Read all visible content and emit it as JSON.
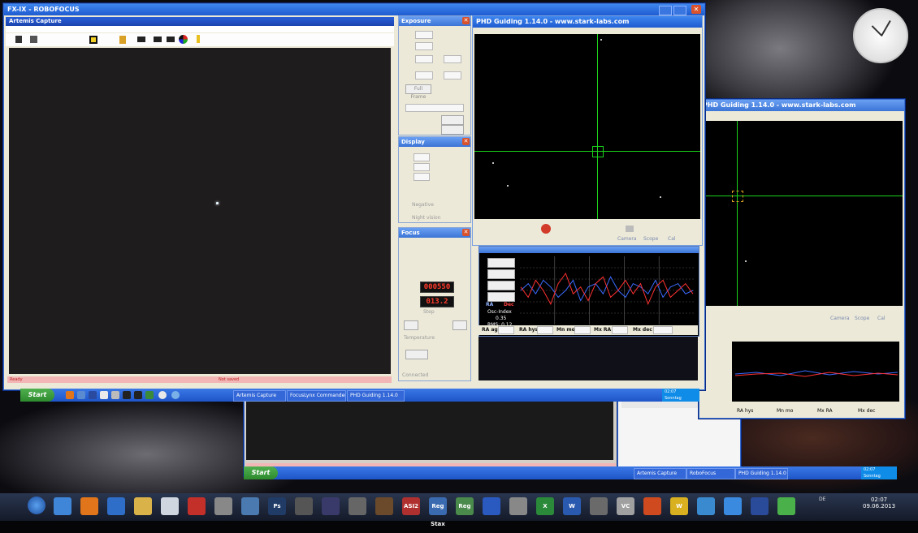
{
  "artemis": {
    "title": "Artemis Capture",
    "window_top_title": "FX-IX - ROBOFOCUS",
    "status": {
      "left": "Ready",
      "mid": "Not saved"
    }
  },
  "exposure_panel": {
    "title": "Exposure",
    "full_frame": "Full Frame"
  },
  "display_panel": {
    "title": "Display",
    "negative": "Negative",
    "night_vision": "Night vision"
  },
  "focus_panel": {
    "title": "Focus",
    "position": "000550",
    "temperature": "013.2",
    "step_label": "Step",
    "temp_label": "Temperature",
    "connected": "Connected"
  },
  "phd_main": {
    "title": "PHD Guiding 1.14.0  -  www.stark-labs.com",
    "camera": "Camera",
    "scope": "Scope",
    "cal": "Cal"
  },
  "phd_graph": {
    "ra_label": "RA",
    "dec_label": "Dec",
    "osc_label": "Osc-Index",
    "osc_value": "0.35",
    "rms": "RMS: 0.12",
    "ra_agr": "RA agr",
    "ra_hys": "RA hys",
    "mn_mo": "Mn mo",
    "mx_ra": "Mx RA",
    "mx_dec": "Mx dec",
    "ra_color": "#ff3030",
    "dec_color": "#3a6bff",
    "chart_data": {
      "type": "line",
      "series": [
        {
          "name": "RA",
          "values": [
            0.1,
            -0.2,
            0.3,
            0.0,
            -0.4,
            0.2,
            0.5,
            -0.1,
            0.1,
            -0.3,
            0.2,
            0.4,
            -0.2,
            0.0,
            0.3,
            -0.1,
            0.2,
            -0.4,
            0.1,
            0.3,
            -0.2,
            0.0,
            0.2,
            -0.1
          ]
        },
        {
          "name": "Dec",
          "values": [
            0.0,
            0.2,
            -0.1,
            0.3,
            0.1,
            -0.2,
            0.0,
            0.3,
            -0.3,
            0.1,
            0.2,
            -0.1,
            0.4,
            0.0,
            -0.2,
            0.2,
            0.1,
            -0.1,
            0.3,
            -0.2,
            0.1,
            0.2,
            -0.1,
            0.0
          ]
        }
      ],
      "ylim": [
        -1,
        1
      ]
    }
  },
  "phd_second": {
    "title": "PHD Guiding 1.14.0  -  www.stark-labs.com",
    "camera": "Camera",
    "scope": "Scope",
    "cal": "Cal",
    "ra_hys": "RA hys",
    "mn_mo": "Mn mo",
    "mx_ra": "Mx RA",
    "mx_dec": "Mx dec"
  },
  "xp_taskbar_main": {
    "start": "Start",
    "tasks": [
      "Artemis Capture",
      "FocusLynx Commander",
      "PHD Guiding 1.14.0"
    ],
    "tray_time": "02:07",
    "tray_day": "Sonntag"
  },
  "xp_taskbar_second": {
    "start": "Start",
    "tasks": [
      "Artemis Capture",
      "RoboFocus",
      "PHD Guiding 1.14.0"
    ],
    "tray_time": "02:07",
    "tray_day": "Sonntag"
  },
  "win7_taskbar": {
    "lang": "DE",
    "time": "02:07",
    "date": "09.06.2013",
    "icons": [
      {
        "name": "ie-icon",
        "label": "",
        "color": "#3f86d8"
      },
      {
        "name": "firefox-icon",
        "label": "",
        "color": "#e0751b"
      },
      {
        "name": "teamviewer-icon",
        "label": "",
        "color": "#2f6ec8"
      },
      {
        "name": "explorer-icon",
        "label": "",
        "color": "#d9b24a"
      },
      {
        "name": "notepad-icon",
        "label": "",
        "color": "#cfd6e0"
      },
      {
        "name": "filezilla-icon",
        "label": "",
        "color": "#c3302a"
      },
      {
        "name": "pen-icon",
        "label": "",
        "color": "#888"
      },
      {
        "name": "maxim-icon",
        "label": "",
        "color": "#4a7ab0"
      },
      {
        "name": "ps-icon",
        "label": "Ps",
        "color": "#1f3b66"
      },
      {
        "name": "star-icon",
        "label": "",
        "color": "#555"
      },
      {
        "name": "nebula-icon",
        "label": "",
        "color": "#3a3a6a"
      },
      {
        "name": "cartes-icon",
        "label": "",
        "color": "#666"
      },
      {
        "name": "deepsky-icon",
        "label": "",
        "color": "#6a4a2a"
      },
      {
        "name": "asi2-icon",
        "label": "ASI2",
        "color": "#b03030"
      },
      {
        "name": "regstax-icon",
        "label": "Reg Stax",
        "color": "#3a6ab0"
      },
      {
        "name": "registax-icon",
        "label": "Reg",
        "color": "#4a8a4a"
      },
      {
        "name": "blue-icon",
        "label": "",
        "color": "#2a5ac0"
      },
      {
        "name": "sharpcap-icon",
        "label": "",
        "color": "#888"
      },
      {
        "name": "excel-icon",
        "label": "X",
        "color": "#2a8a3a"
      },
      {
        "name": "word-icon",
        "label": "W",
        "color": "#2a5ab0"
      },
      {
        "name": "tool-icon",
        "label": "",
        "color": "#6a6a6a"
      },
      {
        "name": "vc-icon",
        "label": "VC",
        "color": "#a0a0a0"
      },
      {
        "name": "ppt-icon",
        "label": "",
        "color": "#d04a20"
      },
      {
        "name": "w-yellow-icon",
        "label": "W",
        "color": "#d8b020"
      },
      {
        "name": "globe-icon",
        "label": "",
        "color": "#3a8ad0"
      },
      {
        "name": "dropbox-icon",
        "label": "",
        "color": "#3a8ae0"
      },
      {
        "name": "flag-icon",
        "label": "",
        "color": "#2a4a9a"
      },
      {
        "name": "clover-icon",
        "label": "",
        "color": "#4ab04a"
      }
    ]
  }
}
